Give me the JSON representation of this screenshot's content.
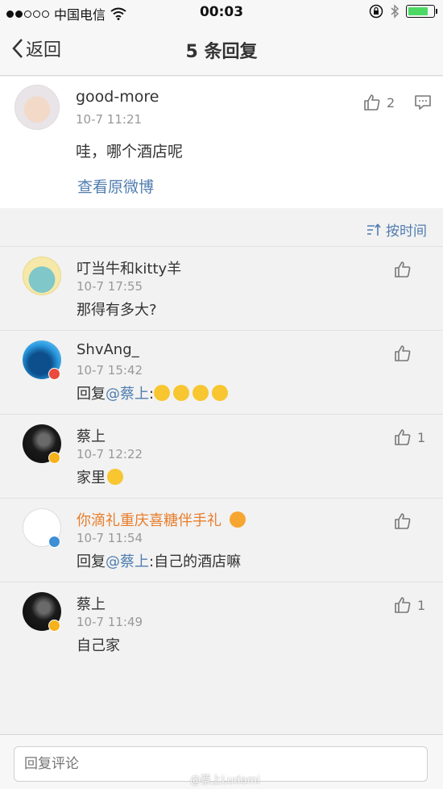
{
  "status_bar": {
    "carrier": "中国电信",
    "time": "00:03"
  },
  "nav": {
    "back_label": "返回",
    "title": "5 条回复"
  },
  "main_comment": {
    "username": "good-more",
    "time": "10-7 11:21",
    "text": "哇，哪个酒店呢",
    "like_count": "2",
    "view_original": "查看原微博"
  },
  "sort": {
    "label": "按时间"
  },
  "replies": [
    {
      "username": "叮当牛和kitty羊",
      "time": "10-7 17:55",
      "prefix": "",
      "mention": "",
      "text": "那得有多大?",
      "like_count": ""
    },
    {
      "username": "ShvAng_",
      "time": "10-7 15:42",
      "prefix": "回复",
      "mention": "@蔡上",
      "text": ":",
      "like_count": ""
    },
    {
      "username": "蔡上",
      "time": "10-7 12:22",
      "prefix": "",
      "mention": "",
      "text": "家里",
      "like_count": "1"
    },
    {
      "username": "你滴礼重庆喜糖伴手礼",
      "time": "10-7 11:54",
      "prefix": "回复",
      "mention": "@蔡上",
      "text": ":自己的酒店嘛",
      "like_count": ""
    },
    {
      "username": "蔡上",
      "time": "10-7 11:49",
      "prefix": "",
      "mention": "",
      "text": "自己家",
      "like_count": "1"
    }
  ],
  "reply_input": {
    "placeholder": "回复评论"
  },
  "watermark": "@蔡上Ludami",
  "colors": {
    "link": "#507daf",
    "highlight_name": "#e87e2c",
    "verified_gold": "#f5b21a",
    "verified_blue": "#3d8fd6",
    "badge_red": "#e94b3c"
  }
}
